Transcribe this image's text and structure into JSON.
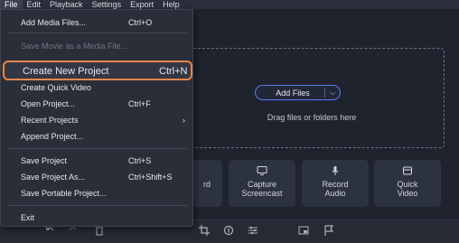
{
  "menubar": {
    "items": [
      {
        "label": "File"
      },
      {
        "label": "Edit"
      },
      {
        "label": "Playback"
      },
      {
        "label": "Settings"
      },
      {
        "label": "Export"
      },
      {
        "label": "Help"
      }
    ]
  },
  "file_menu": {
    "items": [
      {
        "label": "Add Media Files...",
        "shortcut": "Ctrl+O"
      },
      {
        "label": "Save Movie as a Media File...",
        "shortcut": ""
      },
      {
        "label": "Create New Project",
        "shortcut": "Ctrl+N"
      },
      {
        "label": "Create Quick Video",
        "shortcut": ""
      },
      {
        "label": "Open Project...",
        "shortcut": "Ctrl+F"
      },
      {
        "label": "Recent Projects",
        "shortcut": ""
      },
      {
        "label": "Append Project...",
        "shortcut": ""
      },
      {
        "label": "Save Project",
        "shortcut": "Ctrl+S"
      },
      {
        "label": "Save Project As...",
        "shortcut": "Ctrl+Shift+S"
      },
      {
        "label": "Save Portable Project...",
        "shortcut": ""
      },
      {
        "label": "Exit",
        "shortcut": ""
      }
    ]
  },
  "dropzone": {
    "add_files_label": "Add Files",
    "hint": "Drag files or folders here"
  },
  "tiles": [
    {
      "line1": "",
      "line2": "rd",
      "icon": "record-video-icon"
    },
    {
      "line1": "Capture",
      "line2": "Screencast",
      "icon": "monitor-icon"
    },
    {
      "line1": "Record",
      "line2": "Audio",
      "icon": "microphone-icon"
    },
    {
      "line1": "Quick",
      "line2": "Video",
      "icon": "quick-video-icon"
    }
  ],
  "colors": {
    "highlight_outline": "#e8864a",
    "accent_blue": "#5a7cf0",
    "background": "#1f232e",
    "menu_bg": "#2a2e38"
  }
}
